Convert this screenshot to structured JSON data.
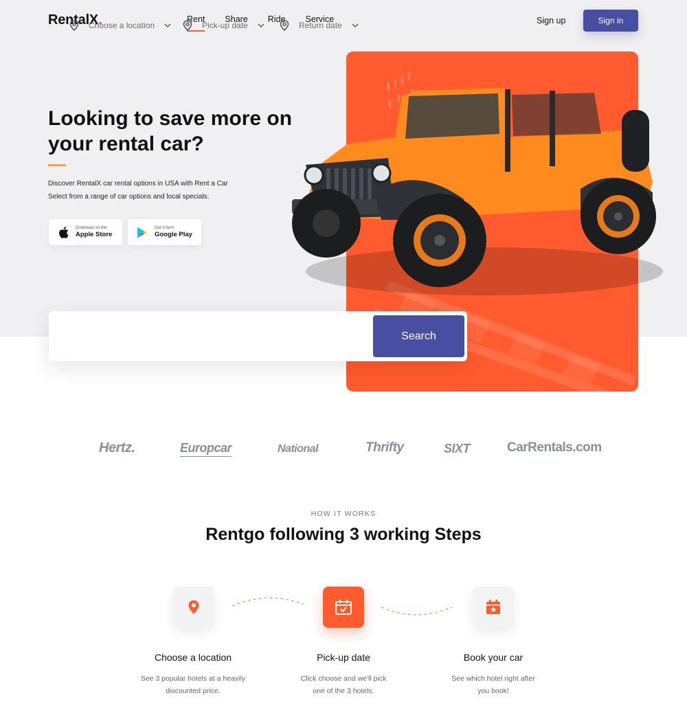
{
  "header": {
    "logo_text": "RentalX",
    "logo_dot": ".",
    "nav": [
      {
        "label": "Rent",
        "active": true
      },
      {
        "label": "Share",
        "active": false
      },
      {
        "label": "Ride",
        "active": false
      },
      {
        "label": "Service",
        "active": false
      }
    ],
    "signup_label": "Sign up",
    "signin_label": "Sign in"
  },
  "hero": {
    "title": "Looking to save more on your rental car?",
    "description_line1": "Discover RentalX car rental options in USA with  Rent a Car",
    "description_line2": "Select from a range of car options and local specials.",
    "apple": {
      "small": "Download on the",
      "big": "Apple Store",
      "icon": "apple-icon"
    },
    "google": {
      "small": "Get it form",
      "big": "Google Play",
      "icon": "google-play-icon"
    }
  },
  "search": {
    "location_label": "Choose a location",
    "pickup_label": "Pick-up date",
    "return_label": "Return date",
    "button_label": "Search",
    "field_icon": "location-pin-icon",
    "dropdown_icon": "chevron-down-icon"
  },
  "brands": [
    "Hertz.",
    "Europcar",
    "National",
    "Thrifty",
    "SIXT",
    "CarRentals.com"
  ],
  "how_it_works": {
    "eyebrow": "HOW IT WORKS",
    "title": "Rentgo following 3 working Steps",
    "steps": [
      {
        "title": "Choose a location",
        "desc_line1": "See 3 popular hotels at a heavily",
        "desc_line2": "discounted price.",
        "icon": "location-pin-icon"
      },
      {
        "title": "Pick-up date",
        "desc_line1": "Click choose and we'll pick",
        "desc_line2": "one of the 3 hotels.",
        "icon": "calendar-check-icon"
      },
      {
        "title": "Book your car",
        "desc_line1": "See which hotel right after",
        "desc_line2": "you book!",
        "icon": "calendar-star-icon"
      }
    ]
  },
  "colors": {
    "accent_orange": "#ff5b2e",
    "accent_yellow": "#ffa42b",
    "primary_indigo": "#484ea2",
    "hero_bg": "#f0f0f2"
  }
}
